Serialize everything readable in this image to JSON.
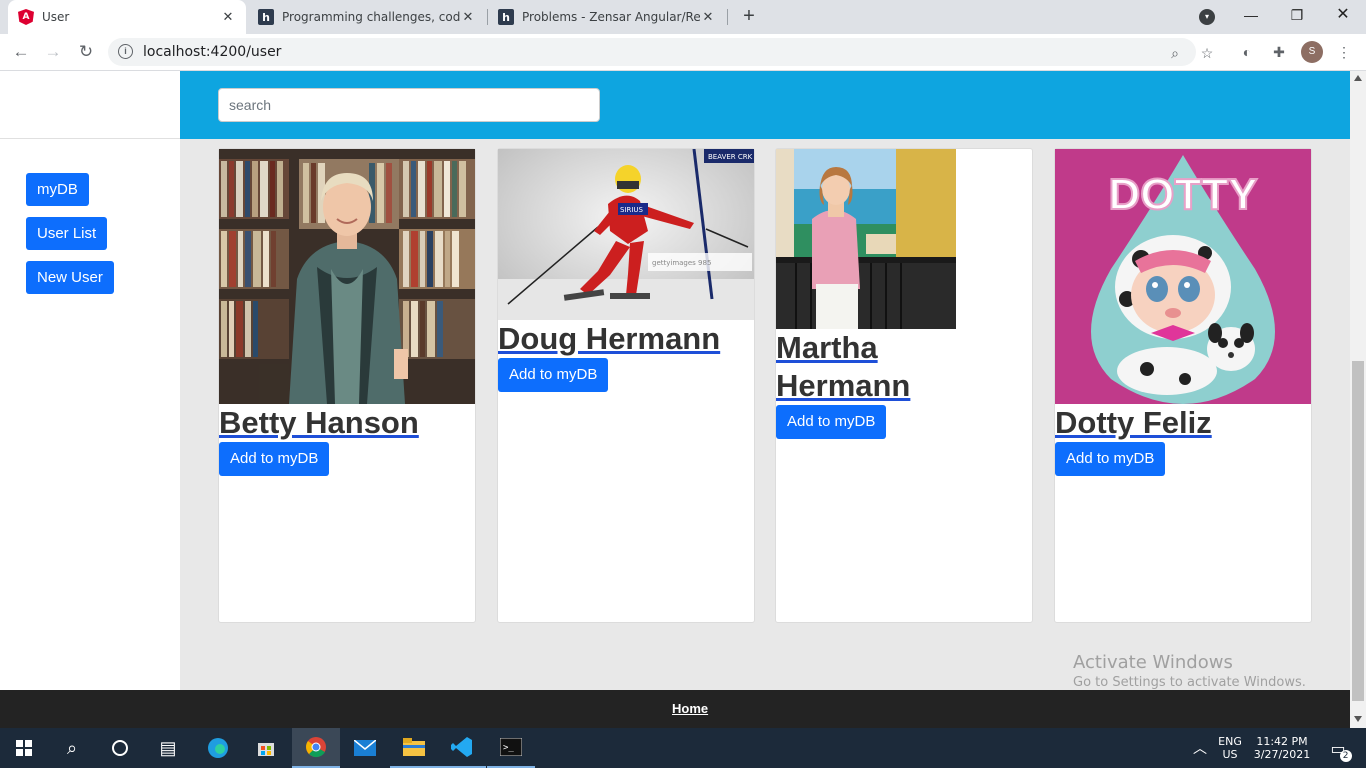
{
  "browser": {
    "tabs": [
      {
        "title": "User",
        "favicon": "angular-icon"
      },
      {
        "title": "Programming challenges, coding",
        "favicon": "h-icon"
      },
      {
        "title": "Problems - Zensar Angular/React",
        "favicon": "h-icon"
      }
    ],
    "url": "localhost:4200/user",
    "profile_initial": "S"
  },
  "sidebar": {
    "buttons": [
      "myDB",
      "User List",
      "New User"
    ]
  },
  "header": {
    "search_placeholder": "search"
  },
  "users": [
    {
      "name": "Betty Hanson",
      "button": "Add to myDB"
    },
    {
      "name": "Doug Hermann",
      "button": "Add to myDB"
    },
    {
      "name": "Martha Hermann",
      "button": "Add to myDB"
    },
    {
      "name": "Dotty Feliz",
      "button": "Add to myDB",
      "image_text": "DOTTY"
    }
  ],
  "footer": {
    "link": "Home"
  },
  "watermark": {
    "line1": "Activate Windows",
    "line2": "Go to Settings to activate Windows."
  },
  "taskbar": {
    "lang1": "ENG",
    "lang2": "US",
    "time": "11:42 PM",
    "date": "3/27/2021",
    "notifications": "2"
  }
}
